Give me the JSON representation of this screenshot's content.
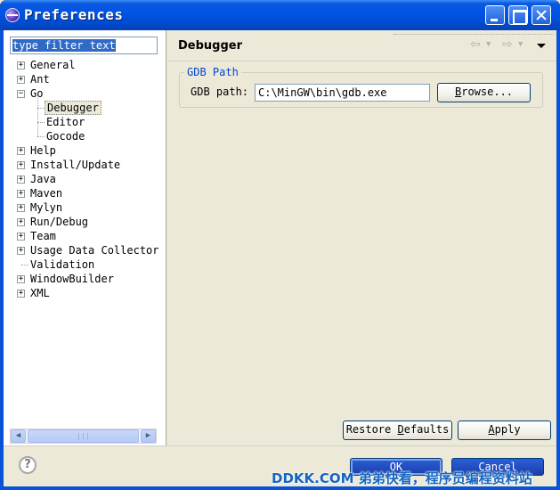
{
  "window": {
    "title": "Preferences"
  },
  "filter": {
    "value": "type filter text"
  },
  "tree": [
    {
      "label": "General",
      "level": 0,
      "expandable": true,
      "expanded": false
    },
    {
      "label": "Ant",
      "level": 0,
      "expandable": true,
      "expanded": false
    },
    {
      "label": "Go",
      "level": 0,
      "expandable": true,
      "expanded": true
    },
    {
      "label": "Debugger",
      "level": 1,
      "expandable": false,
      "selected": true
    },
    {
      "label": "Editor",
      "level": 1,
      "expandable": false
    },
    {
      "label": "Gocode",
      "level": 1,
      "expandable": false
    },
    {
      "label": "Help",
      "level": 0,
      "expandable": true,
      "expanded": false
    },
    {
      "label": "Install/Update",
      "level": 0,
      "expandable": true,
      "expanded": false
    },
    {
      "label": "Java",
      "level": 0,
      "expandable": true,
      "expanded": false
    },
    {
      "label": "Maven",
      "level": 0,
      "expandable": true,
      "expanded": false
    },
    {
      "label": "Mylyn",
      "level": 0,
      "expandable": true,
      "expanded": false
    },
    {
      "label": "Run/Debug",
      "level": 0,
      "expandable": true,
      "expanded": false
    },
    {
      "label": "Team",
      "level": 0,
      "expandable": true,
      "expanded": false
    },
    {
      "label": "Usage Data Collector",
      "level": 0,
      "expandable": true,
      "expanded": false
    },
    {
      "label": "Validation",
      "level": 0,
      "expandable": false
    },
    {
      "label": "WindowBuilder",
      "level": 0,
      "expandable": true,
      "expanded": false
    },
    {
      "label": "XML",
      "level": 0,
      "expandable": true,
      "expanded": false
    }
  ],
  "page": {
    "title": "Debugger",
    "group_title": "GDB Path",
    "gdb_label": "GDB path:",
    "gdb_value": "C:\\MinGW\\bin\\gdb.exe",
    "browse_label": "Browse...",
    "restore_label": "Restore Defaults",
    "apply_label": "Apply"
  },
  "dialog": {
    "ok_label": "OK",
    "cancel_label": "Cancel",
    "help_symbol": "?"
  },
  "watermark": "DDKK.COM 弟弟快看，程序员编程资料站",
  "colors": {
    "titlebar": "#0054e3",
    "accent": "#0046d5",
    "selection": "#316ac5"
  }
}
